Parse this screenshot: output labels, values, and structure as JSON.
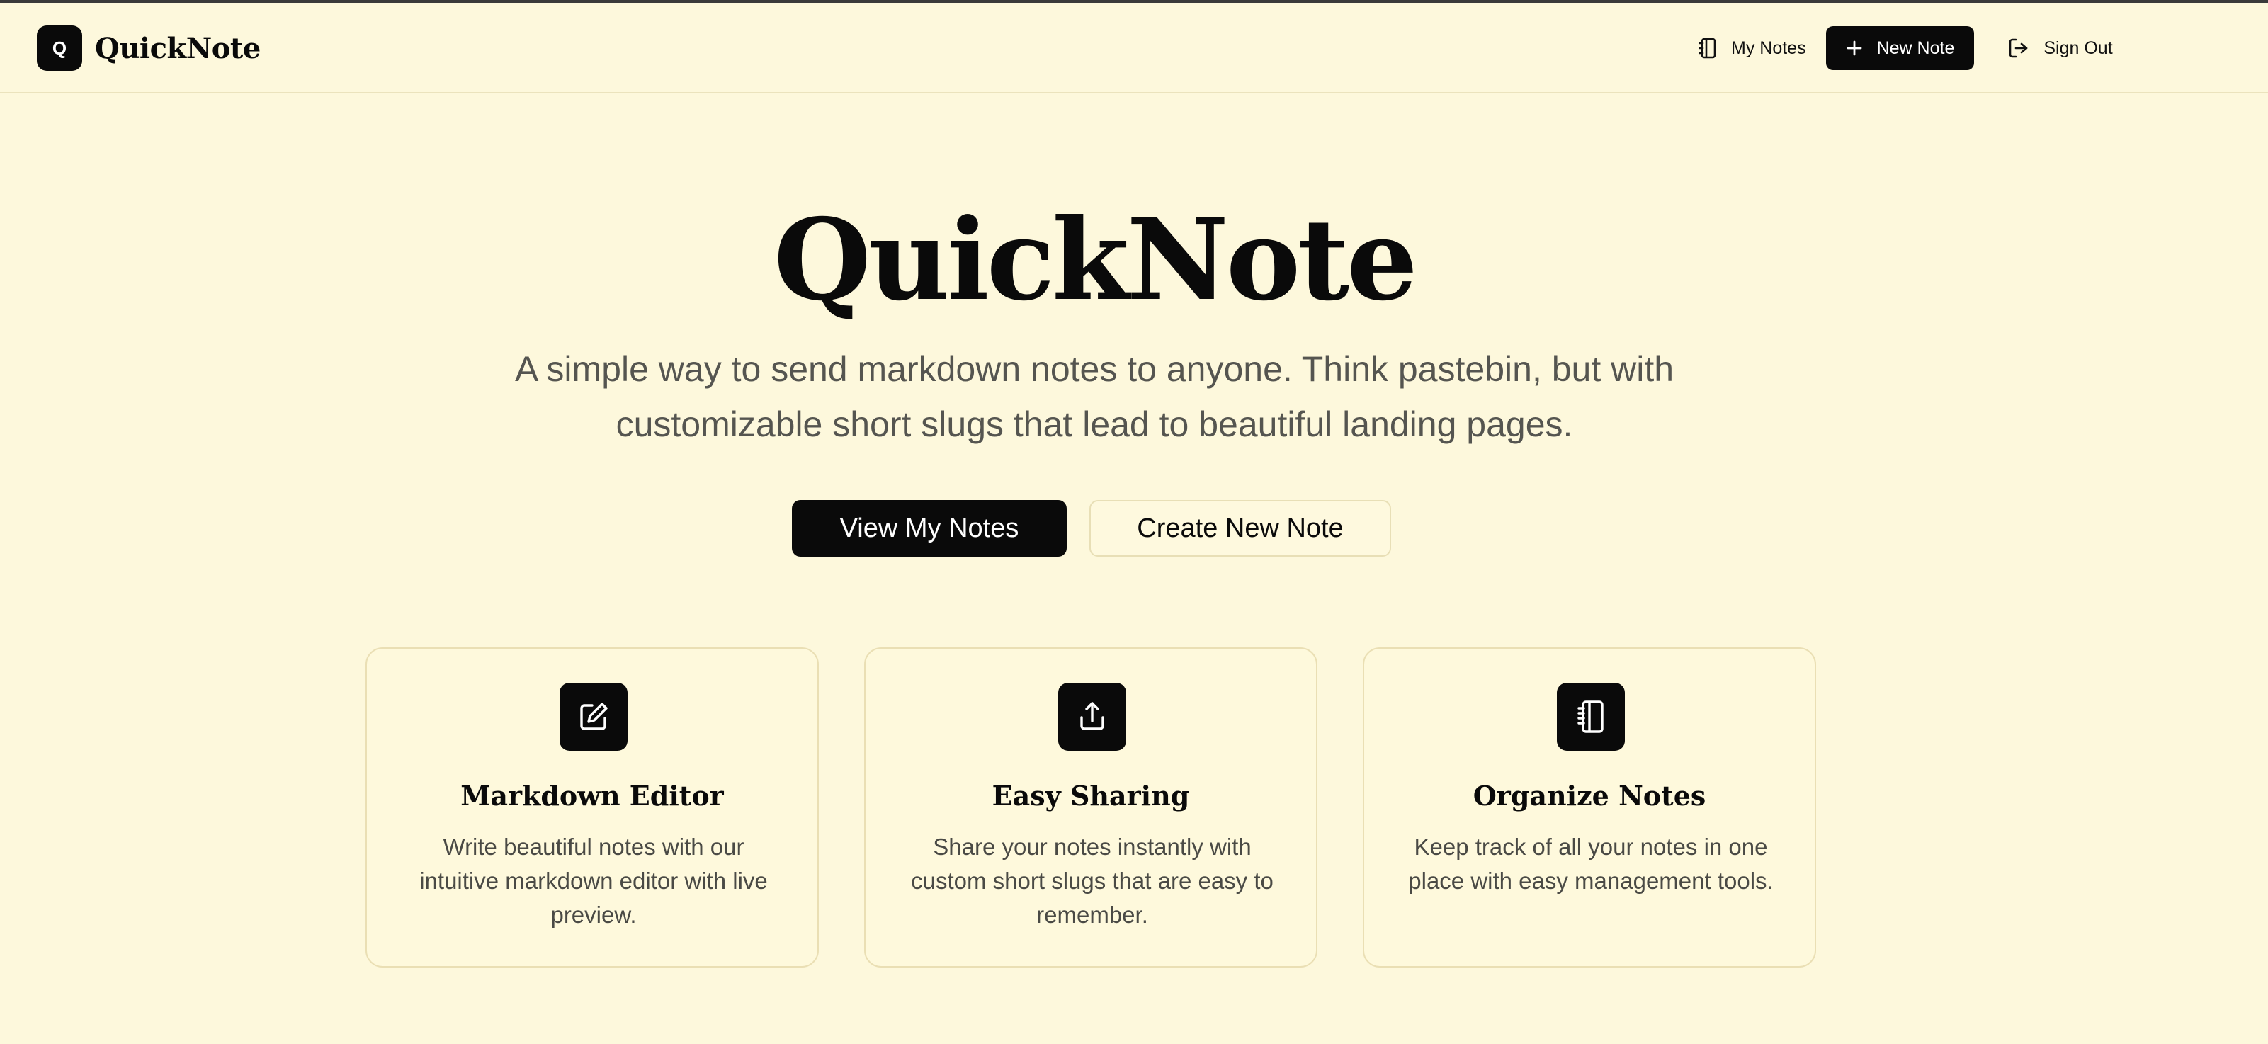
{
  "brand": {
    "badge": "Q",
    "name": "QuickNote"
  },
  "nav": {
    "my_notes": "My Notes",
    "new_note": "New Note",
    "sign_out": "Sign Out"
  },
  "hero": {
    "title": "QuickNote",
    "subtitle": "A simple way to send markdown notes to anyone. Think pastebin, but with customizable short slugs that lead to beautiful landing pages.",
    "primary_cta": "View My Notes",
    "secondary_cta": "Create New Note"
  },
  "features": [
    {
      "icon": "edit-icon",
      "title": "Markdown Editor",
      "description": "Write beautiful notes with our intuitive markdown editor with live preview."
    },
    {
      "icon": "share-icon",
      "title": "Easy Sharing",
      "description": "Share your notes instantly with custom short slugs that are easy to remember."
    },
    {
      "icon": "notebook-icon",
      "title": "Organize Notes",
      "description": "Keep track of all your notes in one place with easy management tools."
    }
  ],
  "colors": {
    "background": "#fdf8dc",
    "primary": "#0a0a0a",
    "muted_text": "#555550",
    "border": "#eadfb4"
  }
}
